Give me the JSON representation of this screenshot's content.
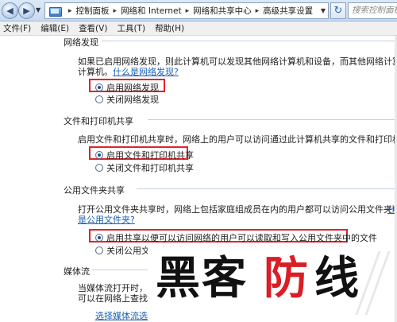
{
  "address_bar": {
    "breadcrumbs": [
      "控制面板",
      "网络和 Internet",
      "网络和共享中心",
      "高级共享设置"
    ],
    "search_placeholder": "搜索控制面板",
    "refresh_icon": "refresh-icon",
    "folder_icon": "control-panel-icon"
  },
  "menu": {
    "items": [
      "文件(F)",
      "编辑(E)",
      "查看(V)",
      "工具(T)",
      "帮助(H)"
    ]
  },
  "sections": {
    "discovery": {
      "title": "网络发现",
      "desc_line1": "如果已启用网络发现，则此计算机可以发现其他网络计算机和设备，而其他网络计算机亦可发现此",
      "desc_line2_prefix": "计算机。",
      "desc_link": "什么是网络发现?",
      "option_on": "启用网络发现",
      "option_off": "关闭网络发现",
      "selected": "on"
    },
    "file_printer": {
      "title": "文件和打印机共享",
      "desc": "启用文件和打印机共享时，网络上的用户可以访问通过此计算机共享的文件和打印机。",
      "option_on": "启用文件和打印机共享",
      "option_off": "关闭文件和打印机共享",
      "selected": "on"
    },
    "public_folder": {
      "title": "公用文件夹共享",
      "desc": "打开公用文件夹共享时，网络上包括家庭组成员在内的用户都可以访问公用文件夹中的文件。",
      "desc_link_right": "什么",
      "link": "是公用文件夹?",
      "option_on": "启用共享以便可以访问网络的用户可以读取和写入公用文件夹中的文件",
      "option_off": "关闭公用文件夹共享(登录到此计算机的用户仍然可以访问这些文件夹)",
      "selected": "on"
    },
    "media": {
      "title": "媒体流",
      "desc_line1": "当媒体流打开时，网络",
      "desc_line2": "可以在网络上查找媒体",
      "link": "选择媒体流选项..."
    }
  },
  "watermark": {
    "chars_black": "黑客",
    "char_red": "防",
    "char_last": "线"
  }
}
